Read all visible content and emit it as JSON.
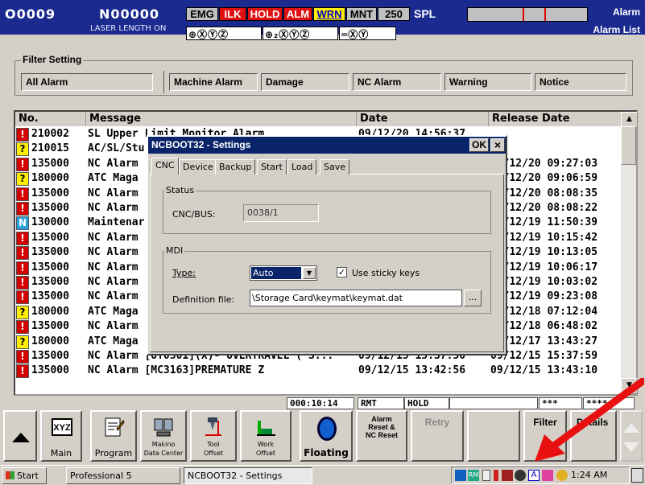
{
  "header": {
    "program": "O0009",
    "sequence": "N00000",
    "laser_length": "LASER LENGTH ON",
    "flags": {
      "emg": "EMG",
      "ilk": "ILK",
      "hold": "HOLD",
      "alm": "ALM",
      "wrn": "WRN",
      "mnt": "MNT",
      "num": "250",
      "spl": "SPL"
    },
    "rings": [
      "⊕ⓍⓎⓏ",
      "⊕₂ⓍⓎⓏ",
      "═ⓍⓎ"
    ],
    "alarm": "Alarm",
    "alarm_list": "Alarm List"
  },
  "filter": {
    "title": "Filter Setting",
    "all": "All Alarm",
    "machine": "Machine Alarm",
    "damage": "Damage",
    "nc": "NC Alarm",
    "warning": "Warning",
    "notice": "Notice"
  },
  "table": {
    "headers": {
      "no": "No.",
      "message": "Message",
      "date": "Date",
      "release": "Release Date"
    },
    "rows": [
      {
        "icon": "!",
        "type": "e",
        "no": "210002",
        "message": "SL Upper Limit Monitor Alarm",
        "date": "09/12/20 14:56:37",
        "release": ""
      },
      {
        "icon": "?",
        "type": "w",
        "no": "210015",
        "message": "AC/SL/Stu",
        "date": "",
        "release": ""
      },
      {
        "icon": "!",
        "type": "e",
        "no": "135000",
        "message": "NC Alarm",
        "date": "",
        "release": "09/12/20 09:27:03"
      },
      {
        "icon": "?",
        "type": "w",
        "no": "180000",
        "message": "ATC Maga",
        "date": "",
        "release": "09/12/20 09:06:59"
      },
      {
        "icon": "!",
        "type": "e",
        "no": "135000",
        "message": "NC Alarm",
        "date": "",
        "release": "09/12/20 08:08:35"
      },
      {
        "icon": "!",
        "type": "e",
        "no": "135000",
        "message": "NC Alarm",
        "date": "",
        "release": "09/12/20 08:08:22"
      },
      {
        "icon": "N",
        "type": "n",
        "no": "130000",
        "message": "Maintenar",
        "date": "",
        "release": "09/12/19 11:50:39"
      },
      {
        "icon": "!",
        "type": "e",
        "no": "135000",
        "message": "NC Alarm",
        "date": "",
        "release": "09/12/19 10:15:42"
      },
      {
        "icon": "!",
        "type": "e",
        "no": "135000",
        "message": "NC Alarm",
        "date": "",
        "release": "09/12/19 10:13:05"
      },
      {
        "icon": "!",
        "type": "e",
        "no": "135000",
        "message": "NC Alarm",
        "date": "",
        "release": "09/12/19 10:06:17"
      },
      {
        "icon": "!",
        "type": "e",
        "no": "135000",
        "message": "NC Alarm",
        "date": "",
        "release": "09/12/19 10:03:02"
      },
      {
        "icon": "!",
        "type": "e",
        "no": "135000",
        "message": "NC Alarm",
        "date": "",
        "release": "09/12/19 09:23:08"
      },
      {
        "icon": "?",
        "type": "w",
        "no": "180000",
        "message": "ATC Maga",
        "date": "",
        "release": "09/12/18 07:12:04"
      },
      {
        "icon": "!",
        "type": "e",
        "no": "135000",
        "message": "NC Alarm",
        "date": "",
        "release": "09/12/18 06:48:02"
      },
      {
        "icon": "?",
        "type": "w",
        "no": "180000",
        "message": "ATC Maga",
        "date": "",
        "release": "09/12/17 13:43:27"
      },
      {
        "icon": "!",
        "type": "e",
        "no": "135000",
        "message": "NC Alarm [OT0501](X)- OVERTRAVEL ( S...",
        "date": "09/12/15 15:37:50",
        "release": "09/12/15 15:37:59"
      },
      {
        "icon": "!",
        "type": "e",
        "no": "135000",
        "message": "NC Alarm [MC3163]PREMATURE Z",
        "date": "09/12/15 13:42:56",
        "release": "09/12/15 13:43:10"
      }
    ]
  },
  "status_strip": {
    "time": "000:10:14",
    "mode": "RMT",
    "state": "HOLD",
    "s1": "***",
    "s2": "****"
  },
  "softkeys": {
    "main": "Main",
    "xyz": "XYZ",
    "program": "Program",
    "makino": "Makino\nData Center",
    "tool": "Tool\nOffset",
    "work": "Work\nOffset",
    "floating": "Floating",
    "alarm_reset": "Alarm\nReset &\nNC Reset",
    "retry": "Retry",
    "filter": "Filter",
    "details": "Details"
  },
  "taskbar": {
    "start": "Start",
    "task1": "Professional 5",
    "task2": "NCBOOT32 - Settings",
    "clock": "1:24 AM"
  },
  "dialog": {
    "title": "NCBOOT32 - Settings",
    "ok": "OK",
    "close": "×",
    "tabs": [
      "CNC",
      "Device",
      "Backup",
      "Start",
      "Load",
      "Save"
    ],
    "status_group": "Status",
    "cnc_bus_label": "CNC/BUS:",
    "cnc_bus_value": "0038/1",
    "mdi_group": "MDI",
    "type_label": "Type:",
    "type_value": "Auto",
    "sticky_label": "Use sticky keys",
    "sticky_checked": true,
    "def_label": "Definition file:",
    "def_value": "\\Storage Card\\keymat\\keymat.dat",
    "browse": "..."
  },
  "colors": {
    "header_bg": "#1b2a8e",
    "dialog_title": "#0a246a",
    "error_icon": "#d40000",
    "warn_icon": "#ffee00",
    "notice_icon": "#28a0e0",
    "annotation_arrow": "#e81010"
  }
}
